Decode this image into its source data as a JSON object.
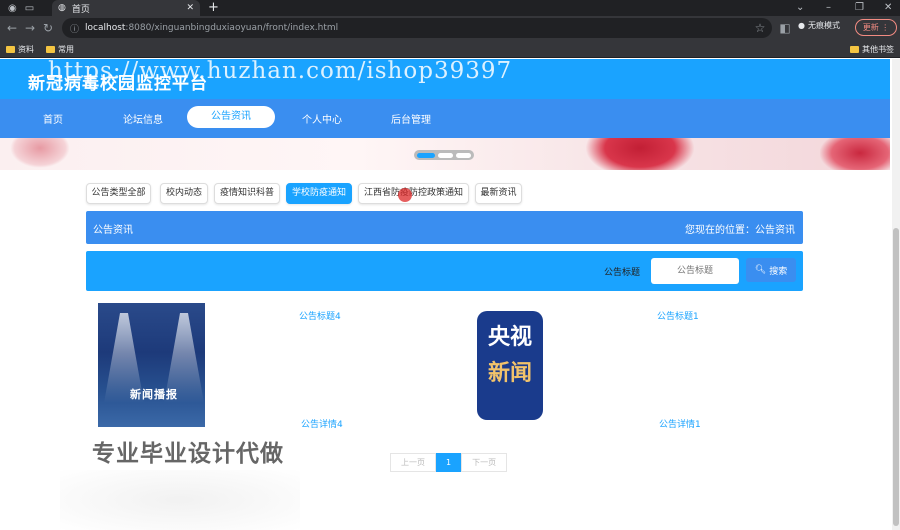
{
  "browser": {
    "active_tab": "首页",
    "new_tab": "+",
    "url_host": "localhost",
    "url_rest": ":8080/xinguanbingduxiaoyuan/front/index.html",
    "incognito_label": "无痕模式",
    "update_label": "更新",
    "bookmarks": [
      "资料",
      "常用"
    ],
    "other_bookmarks": "其他书签"
  },
  "site": {
    "title": "新冠病毒校园监控平台",
    "watermark_url": "https://www.huzhan.com/ishop39397"
  },
  "nav": {
    "items": [
      "首页",
      "论坛信息",
      "公告资讯",
      "个人中心",
      "后台管理"
    ]
  },
  "categories": [
    "公告类型全部",
    "校内动态",
    "疫情知识科普",
    "学校防疫通知",
    "江西省防疫防控政策通知",
    "最新资讯"
  ],
  "breadcrumb": {
    "title": "公告资讯",
    "location": "您现在的位置：公告资讯"
  },
  "search": {
    "label": "公告标题",
    "placeholder": "公告标题",
    "button": "搜索"
  },
  "cards": [
    {
      "image_caption": "新闻播报",
      "title": "公告标题4",
      "detail": "公告详情4"
    },
    {
      "image_lines": [
        "央视",
        "新闻"
      ],
      "title": "公告标题1",
      "detail": "公告详情1"
    }
  ],
  "slogan": "专业毕业设计代做",
  "pagination": {
    "prev": "上一页",
    "current": "1",
    "next": "下一页"
  },
  "colors": {
    "primary": "#1aa3ff",
    "nav_bg": "#3a8ef0"
  }
}
